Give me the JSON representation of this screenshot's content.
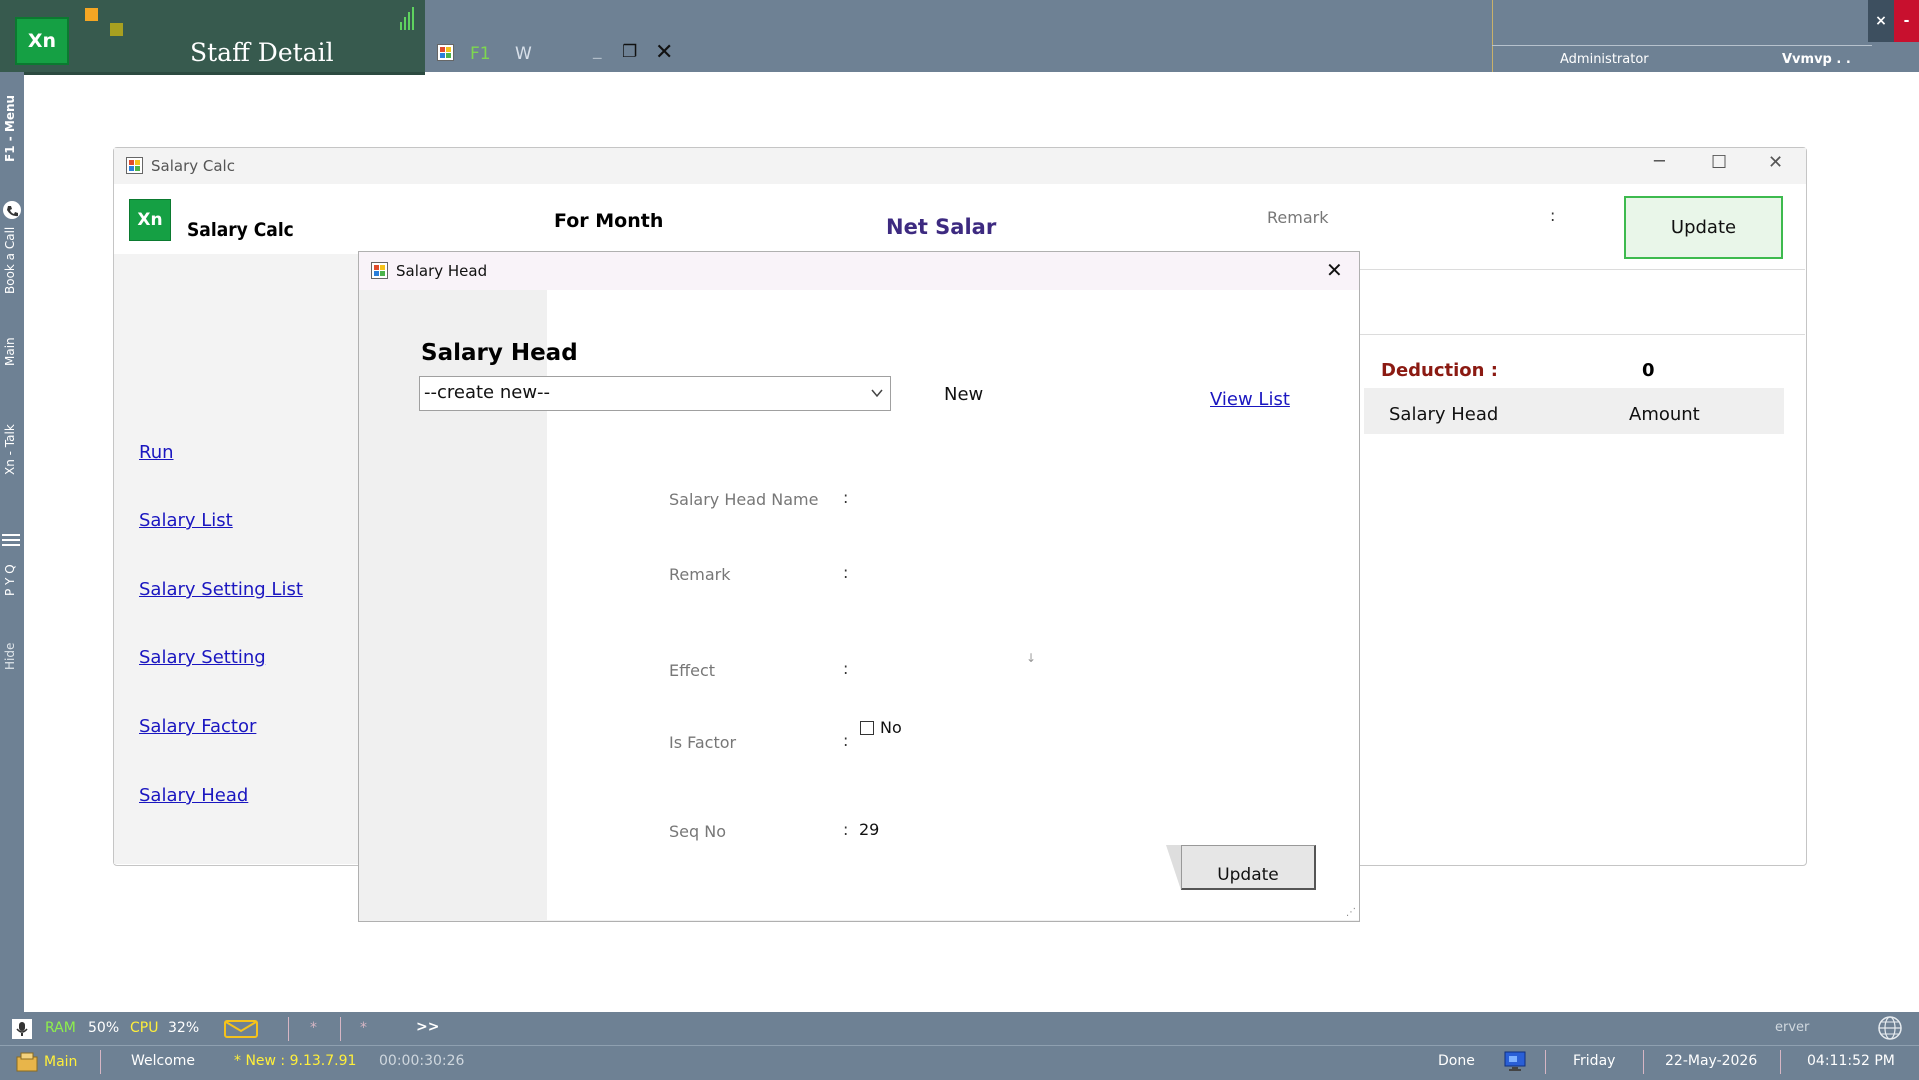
{
  "topbar": {
    "logo_text": "Xn",
    "app_title": "Staff Detail",
    "f1": "F1",
    "w": "W",
    "user": "Administrator",
    "site": "Vvmvp . .",
    "close_x": "×",
    "close_dash": "-"
  },
  "leftstrip": {
    "items": [
      "F1 - Menu",
      "Book a Call",
      "Main",
      "Xn - Talk",
      "P Y Q",
      "Hide"
    ]
  },
  "salary_calc": {
    "window_title": "Salary Calc",
    "logo_text": "Xn",
    "heading": "Salary Calc",
    "for_month": "For Month",
    "net_salary": "Net Salary :",
    "remark_label": "Remark",
    "remark_colon": ":",
    "update": "Update",
    "nav": [
      "Run",
      "Salary List",
      "Salary Setting List",
      "Salary Setting",
      "Salary Factor",
      "Salary Head"
    ],
    "deduction_label": "Deduction :",
    "deduction_value": "0",
    "table_headers": [
      "Salary Head",
      "Amount"
    ]
  },
  "salary_head": {
    "window_title": "Salary Head",
    "heading": "Salary Head",
    "select_value": "--create new--",
    "new_label": "New",
    "view_list": "View List",
    "fields": {
      "name_label": "Salary Head Name",
      "remark_label": "Remark",
      "effect_label": "Effect",
      "is_factor_label": "Is Factor",
      "seq_no_label": "Seq No",
      "colon": ":"
    },
    "is_factor_checked": false,
    "is_factor_text": "No",
    "seq_no": "29",
    "update": "Update"
  },
  "statusbar": {
    "ram_label": "RAM",
    "ram_value": "50%",
    "cpu_label": "CPU",
    "cpu_value": "32%",
    "star1": "*",
    "star2": "*",
    "more": ">>",
    "server": "erver",
    "main": "Main",
    "welcome": "Welcome",
    "version": "* New : 9.13.7.91",
    "timer": "00:00:30:26",
    "done": "Done",
    "day": "Friday",
    "date": "22-May-2026",
    "time": "04:11:52 PM"
  },
  "colors": {
    "chrome": "#6e8194",
    "accent_green": "#15a044",
    "link_blue": "#1a16c0",
    "deduction_red": "#8b1a12"
  }
}
